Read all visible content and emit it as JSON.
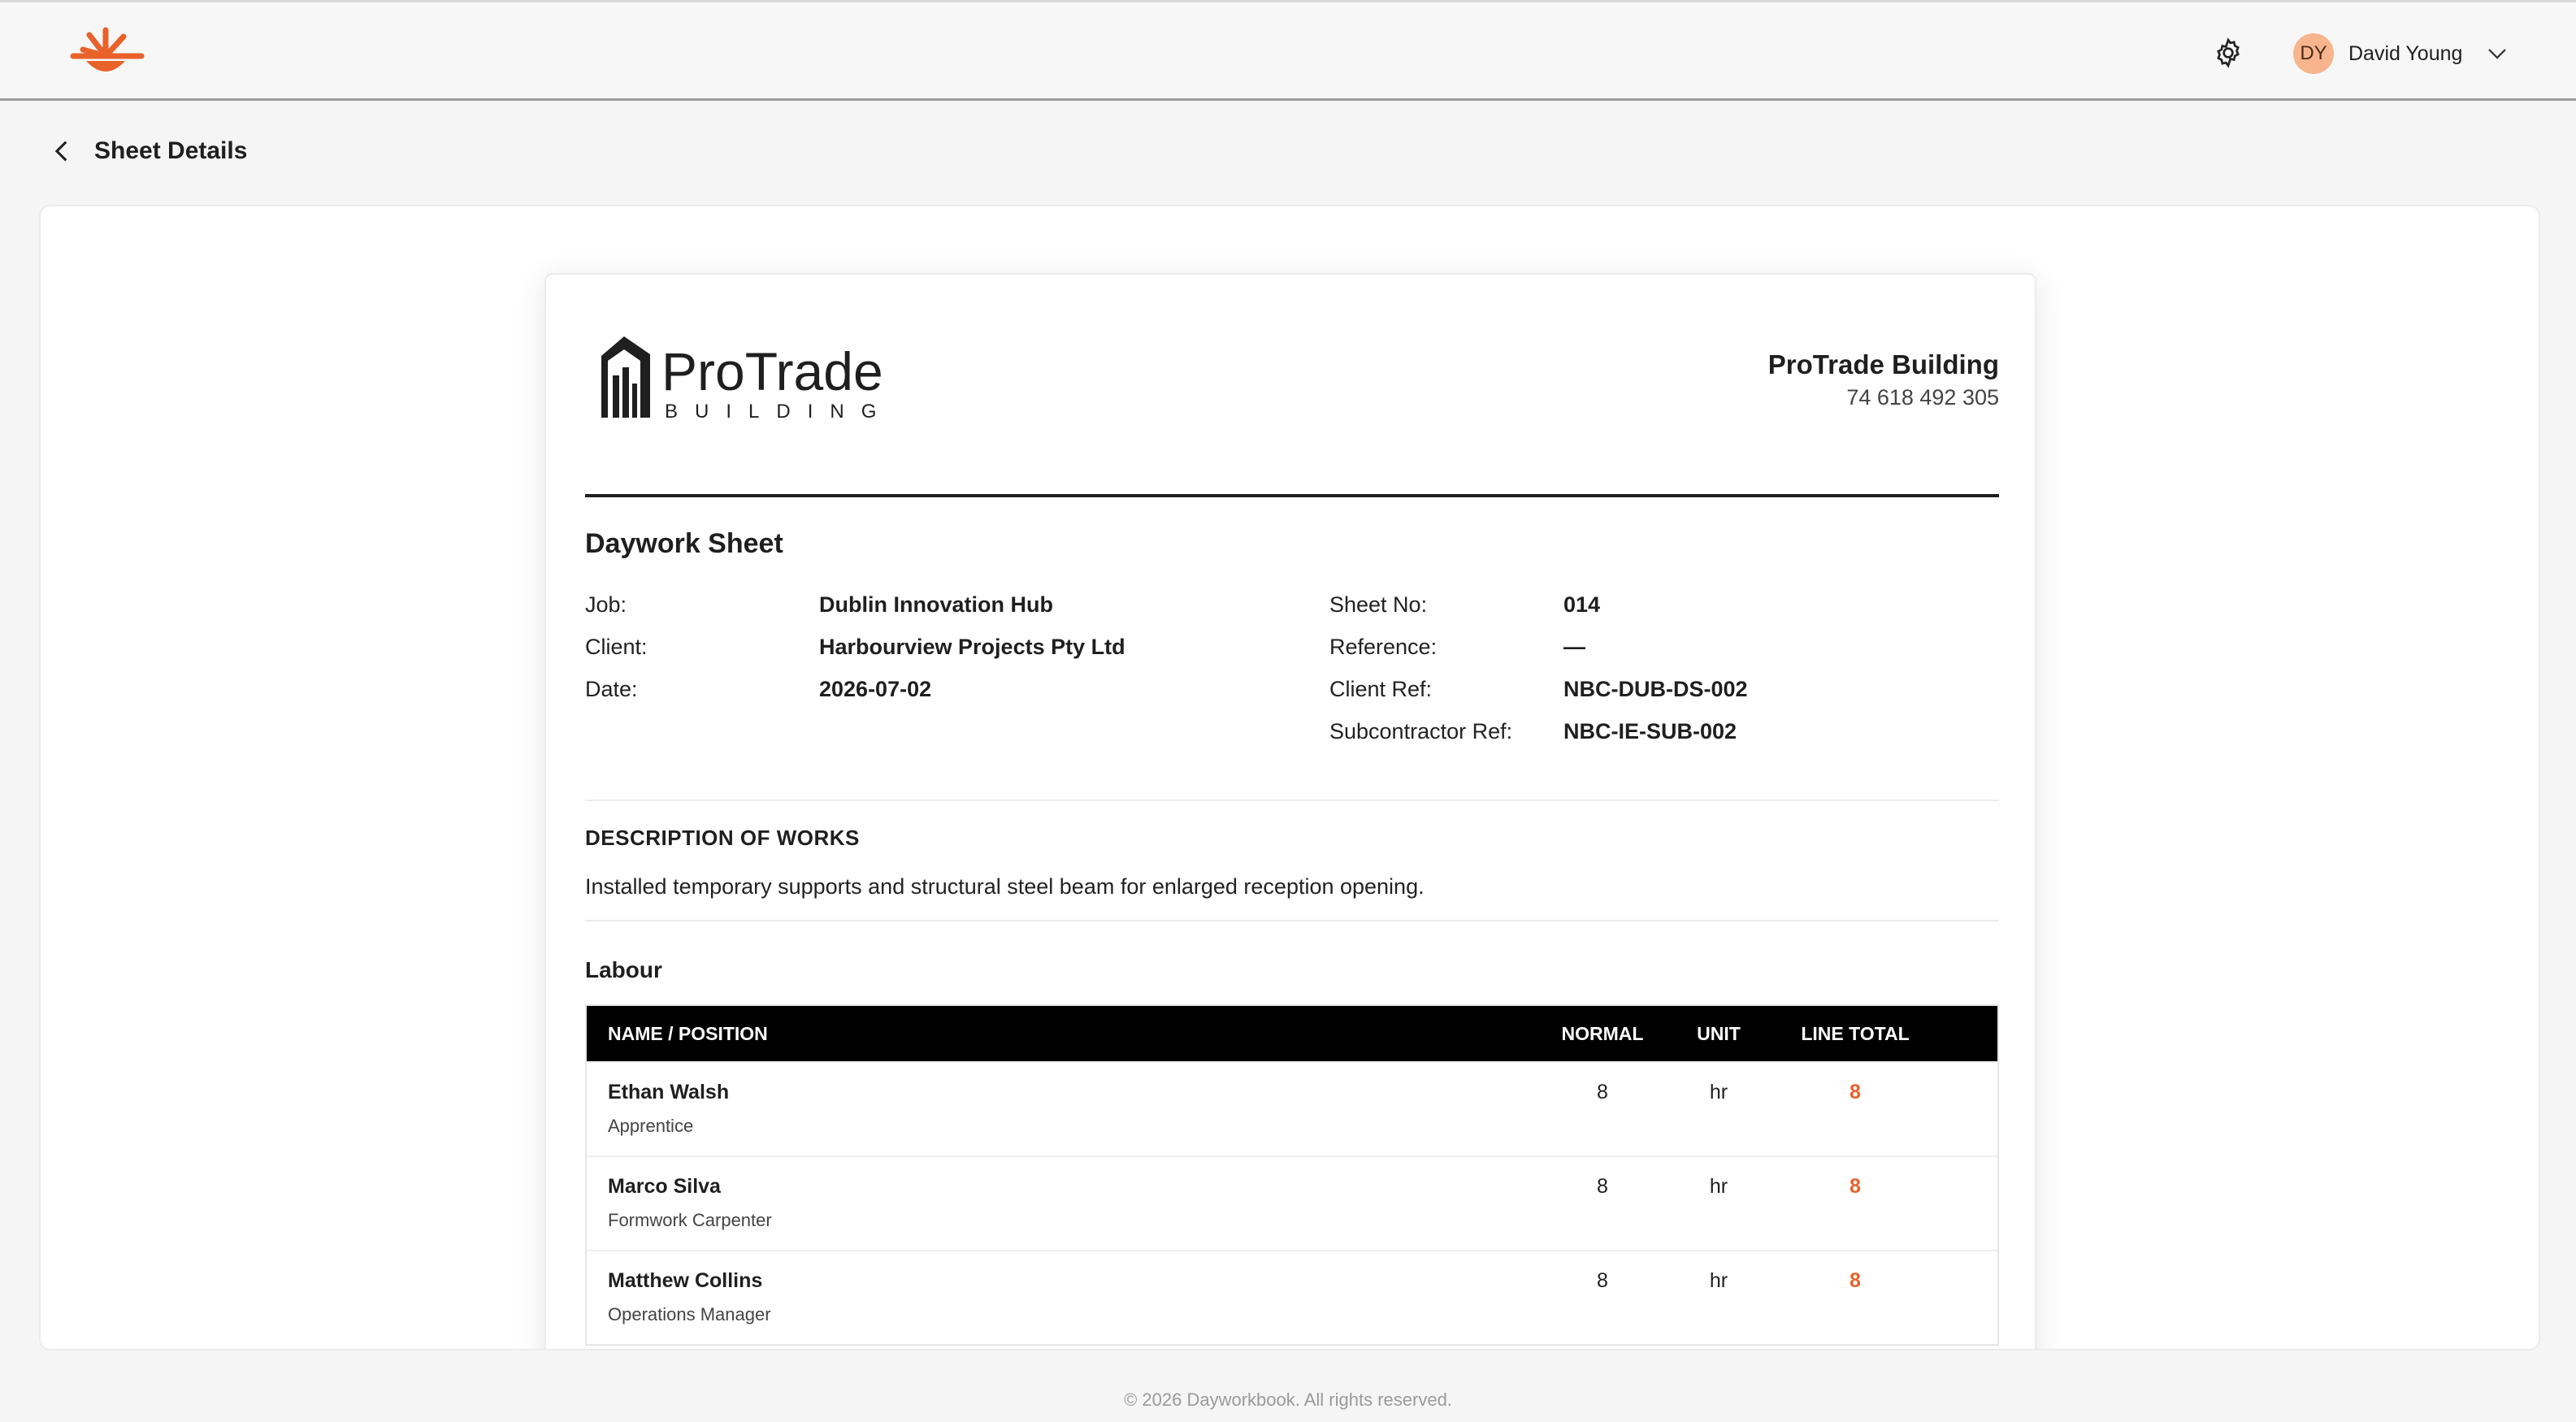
{
  "header": {
    "user_initials": "DY",
    "user_name": "David Young",
    "accent_color": "#e8622a",
    "icons": [
      "sunburst-logo-icon",
      "gear-icon",
      "chevron-down-icon"
    ]
  },
  "page": {
    "title": "Sheet Details",
    "back_icon": "chevron-left-icon"
  },
  "document": {
    "brand_wordmark": "ProTrade",
    "brand_subtitle": "BUILDING",
    "company_name": "ProTrade Building",
    "company_number": "74 618 492 305",
    "sheet_title": "Daywork Sheet",
    "meta_left": [
      {
        "label": "Job:",
        "value": "Dublin Innovation Hub"
      },
      {
        "label": "Client:",
        "value": "Harbourview Projects Pty Ltd"
      },
      {
        "label": "Date:",
        "value": "2026-07-02"
      }
    ],
    "meta_right": [
      {
        "label": "Sheet No:",
        "value": "014"
      },
      {
        "label": "Reference:",
        "value": "—"
      },
      {
        "label": "Client Ref:",
        "value": "NBC-DUB-DS-002"
      },
      {
        "label": "Subcontractor Ref:",
        "value": "NBC-IE-SUB-002"
      }
    ],
    "description_heading": "DESCRIPTION OF WORKS",
    "description_text": "Installed temporary supports and structural steel beam for enlarged reception opening.",
    "labour_heading": "Labour",
    "labour_columns": [
      "NAME / POSITION",
      "NORMAL",
      "UNIT",
      "LINE TOTAL"
    ],
    "labour_rows": [
      {
        "name": "Ethan Walsh",
        "position": "Apprentice",
        "normal": "8",
        "unit": "hr",
        "line_total": "8"
      },
      {
        "name": "Marco Silva",
        "position": "Formwork Carpenter",
        "normal": "8",
        "unit": "hr",
        "line_total": "8"
      },
      {
        "name": "Matthew Collins",
        "position": "Operations Manager",
        "normal": "8",
        "unit": "hr",
        "line_total": "8"
      }
    ]
  },
  "footer": {
    "text": "© 2026 Dayworkbook. All rights reserved."
  }
}
